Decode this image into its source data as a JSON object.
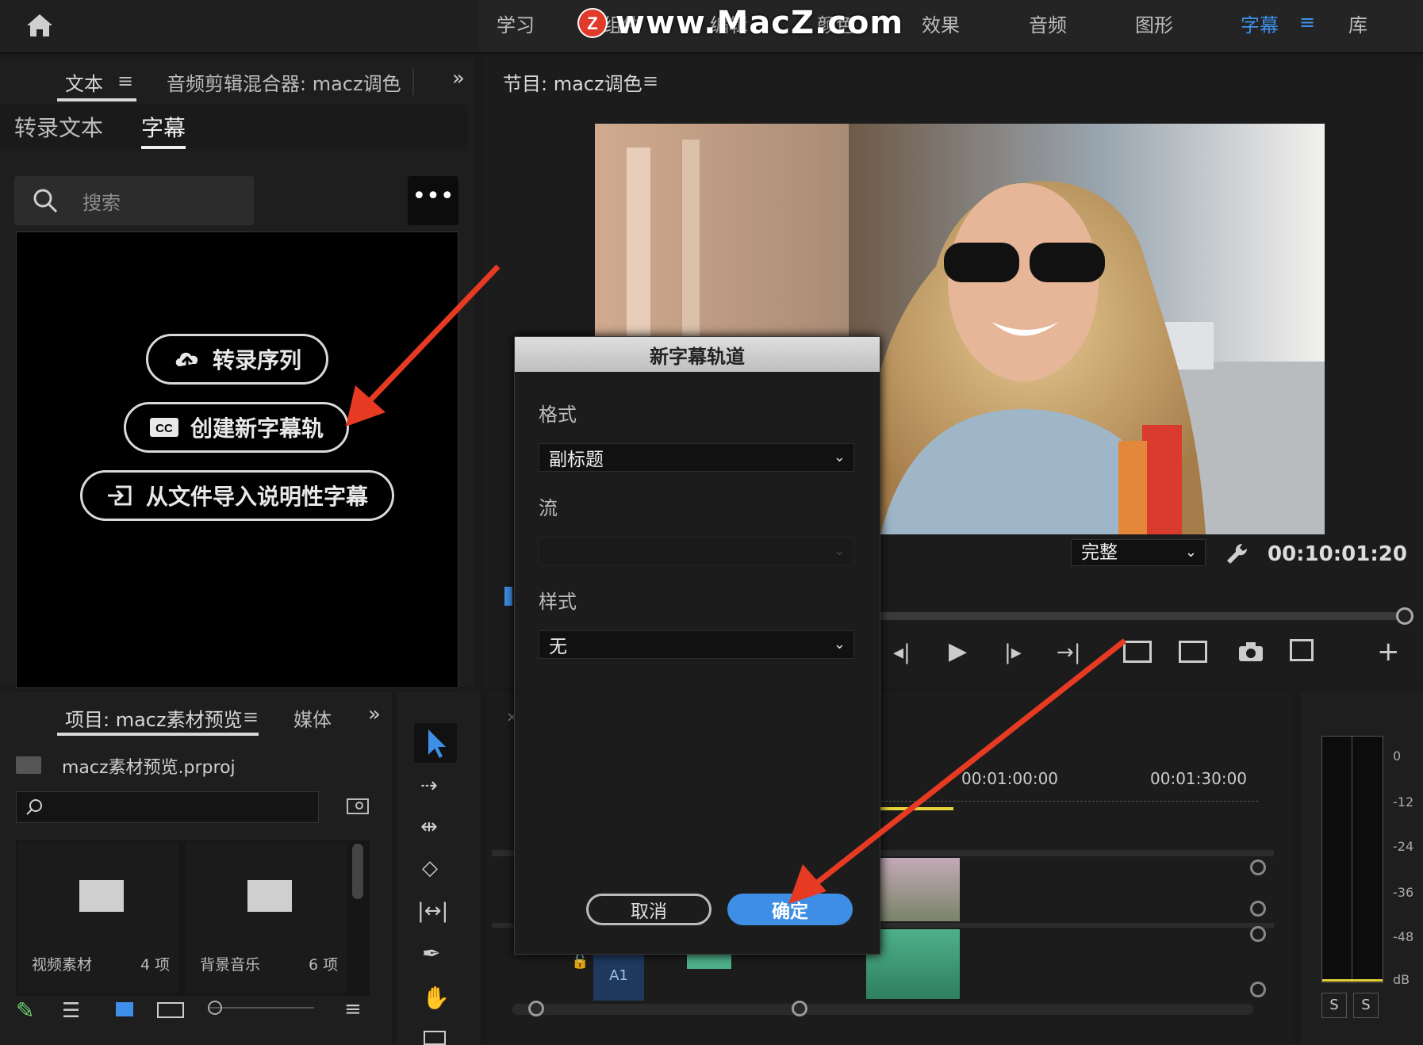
{
  "topbar": {
    "workspaces": [
      "学习",
      "组件",
      "编辑",
      "颜色",
      "效果",
      "音频",
      "图形",
      "字幕",
      "库"
    ],
    "active": "字幕",
    "watermark": "www.MacZ.com"
  },
  "text_panel": {
    "tab_text": "文本",
    "tab_audio_mixer": "音频剪辑混合器: macz调色",
    "sub_tab_transcript": "转录文本",
    "sub_tab_captions": "字幕",
    "search_placeholder": "搜索",
    "btn_transcribe": "转录序列",
    "btn_new_track": "创建新字幕轨",
    "btn_import": "从文件导入说明性字幕"
  },
  "program_panel": {
    "title": "节目: macz调色",
    "quality": "完整",
    "timecode": "00:10:01:20"
  },
  "dialog": {
    "title": "新字幕轨道",
    "format_label": "格式",
    "format_value": "副标题",
    "stream_label": "流",
    "stream_value": "",
    "style_label": "样式",
    "style_value": "无",
    "cancel": "取消",
    "ok": "确定"
  },
  "project_panel": {
    "tab_project": "项目: macz素材预览",
    "tab_media": "媒体",
    "project_file": "macz素材预览.prproj",
    "bins": [
      {
        "name": "视频素材",
        "count": "4 项"
      },
      {
        "name": "背景音乐",
        "count": "6 项"
      }
    ]
  },
  "timeline": {
    "time_labels": [
      "00:01:00:00",
      "00:01:30:00"
    ],
    "track_label": "A1"
  },
  "audio_meter": {
    "labels": [
      "0",
      "-12",
      "-24",
      "-36",
      "-48",
      "dB"
    ],
    "solo": [
      "S",
      "S"
    ]
  },
  "colors": {
    "accent": "#3d8fe8",
    "arrow": "#e63a23",
    "ok_button": "#3e8ee6"
  }
}
